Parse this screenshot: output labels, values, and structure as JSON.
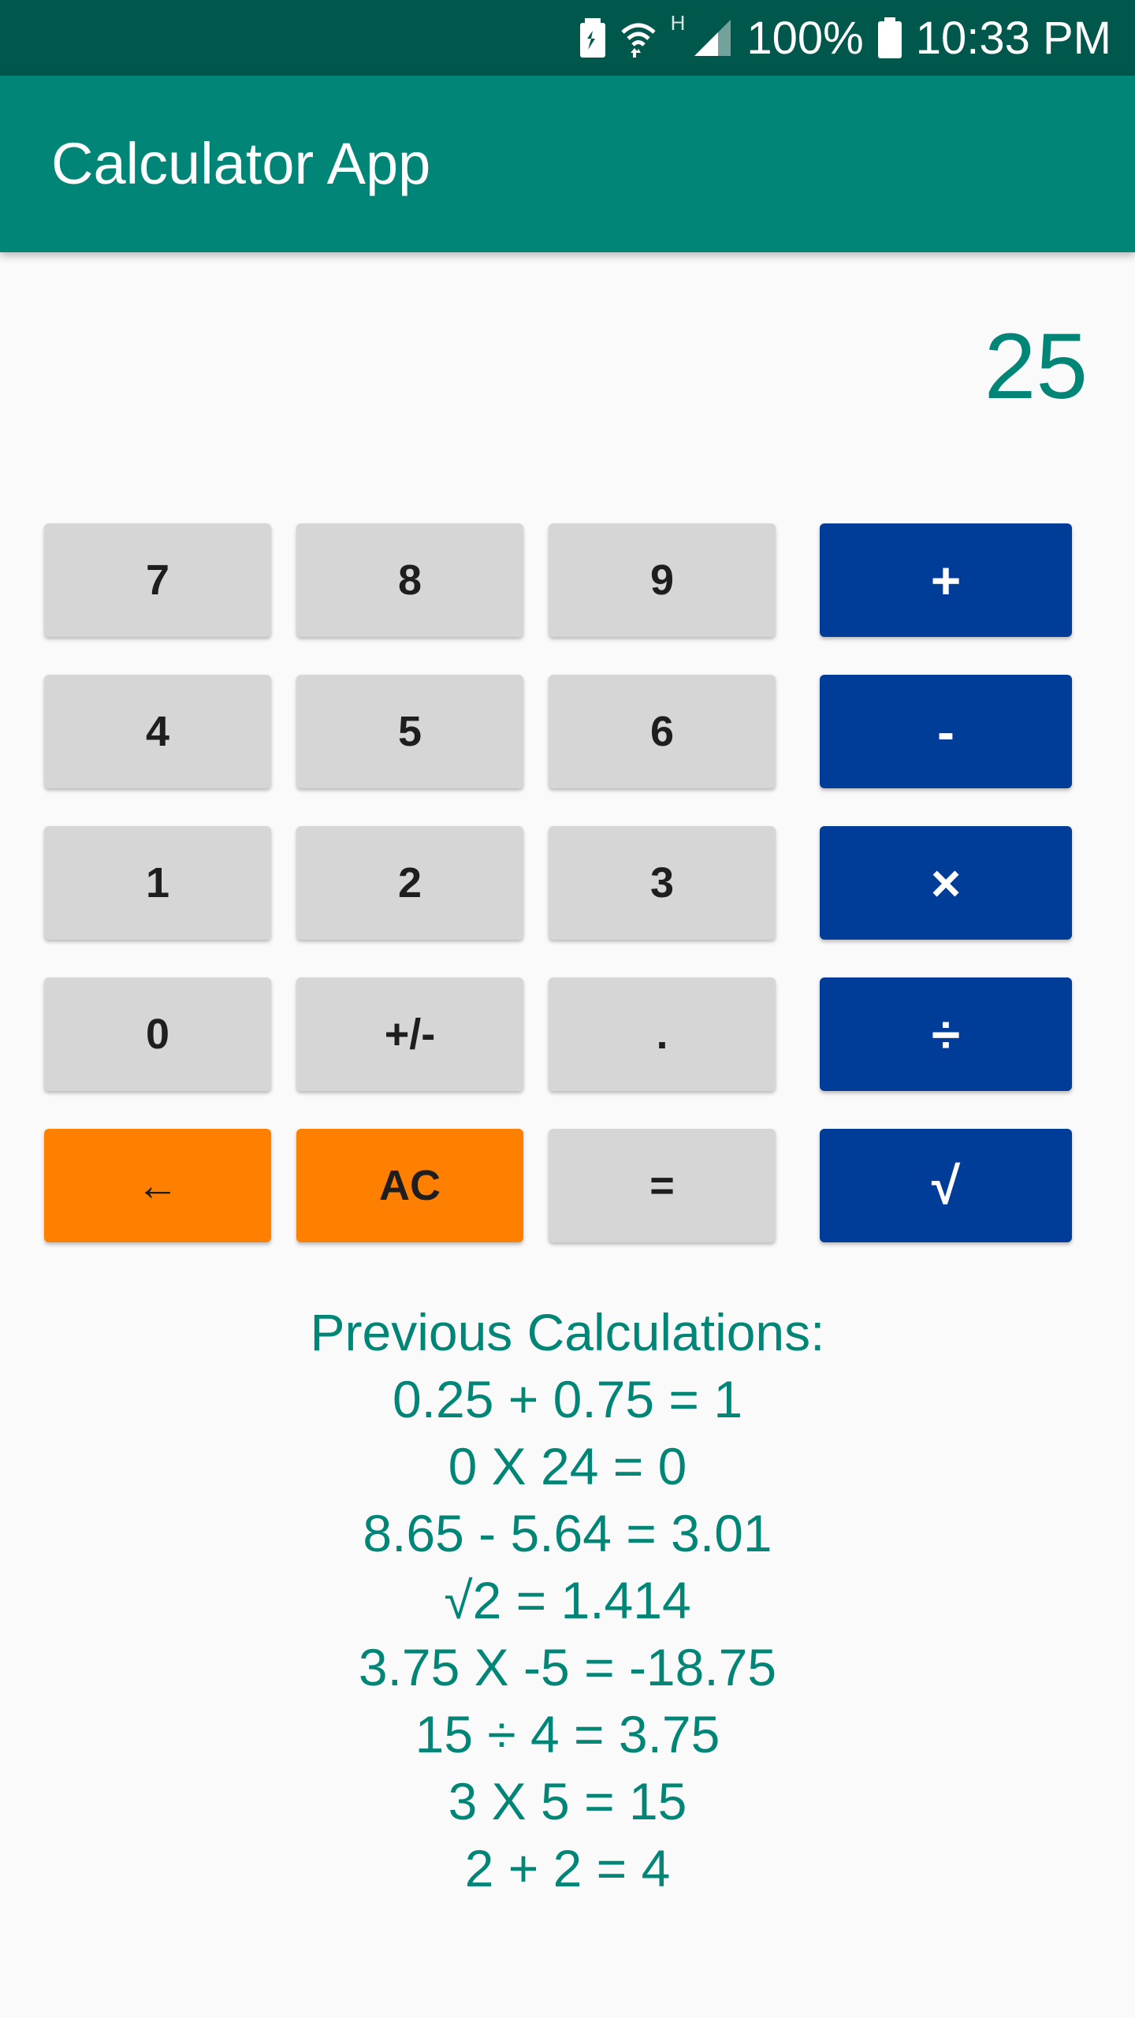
{
  "status_bar": {
    "battery_percent": "100%",
    "time": "10:33 PM",
    "network_label": "H",
    "icons": [
      "battery-saver-icon",
      "wifi-icon",
      "signal-icon",
      "battery-icon"
    ]
  },
  "app_bar": {
    "title": "Calculator App"
  },
  "display": {
    "value": "25"
  },
  "keypad": {
    "rows": [
      [
        "7",
        "8",
        "9",
        "+"
      ],
      [
        "4",
        "5",
        "6",
        "-"
      ],
      [
        "1",
        "2",
        "3",
        "×"
      ],
      [
        "0",
        "+/-",
        ".",
        "÷"
      ],
      [
        "←",
        "AC",
        "=",
        "√"
      ]
    ]
  },
  "history": {
    "heading": "Previous Calculations:",
    "items": [
      "0.25 + 0.75 = 1",
      "0 X 24 = 0",
      "8.65 - 5.64 = 3.01",
      "√2 = 1.414",
      "3.75 X -5 = -18.75",
      "15 ÷ 4 = 3.75",
      "3 X 5 = 15",
      "2 + 2 = 4"
    ]
  },
  "colors": {
    "status_bar": "#00574b",
    "app_bar": "#008577",
    "accent_text": "#008577",
    "number_button": "#d6d6d6",
    "operator_button": "#003d99",
    "clear_button": "#ff8000",
    "background": "#fafafa"
  }
}
